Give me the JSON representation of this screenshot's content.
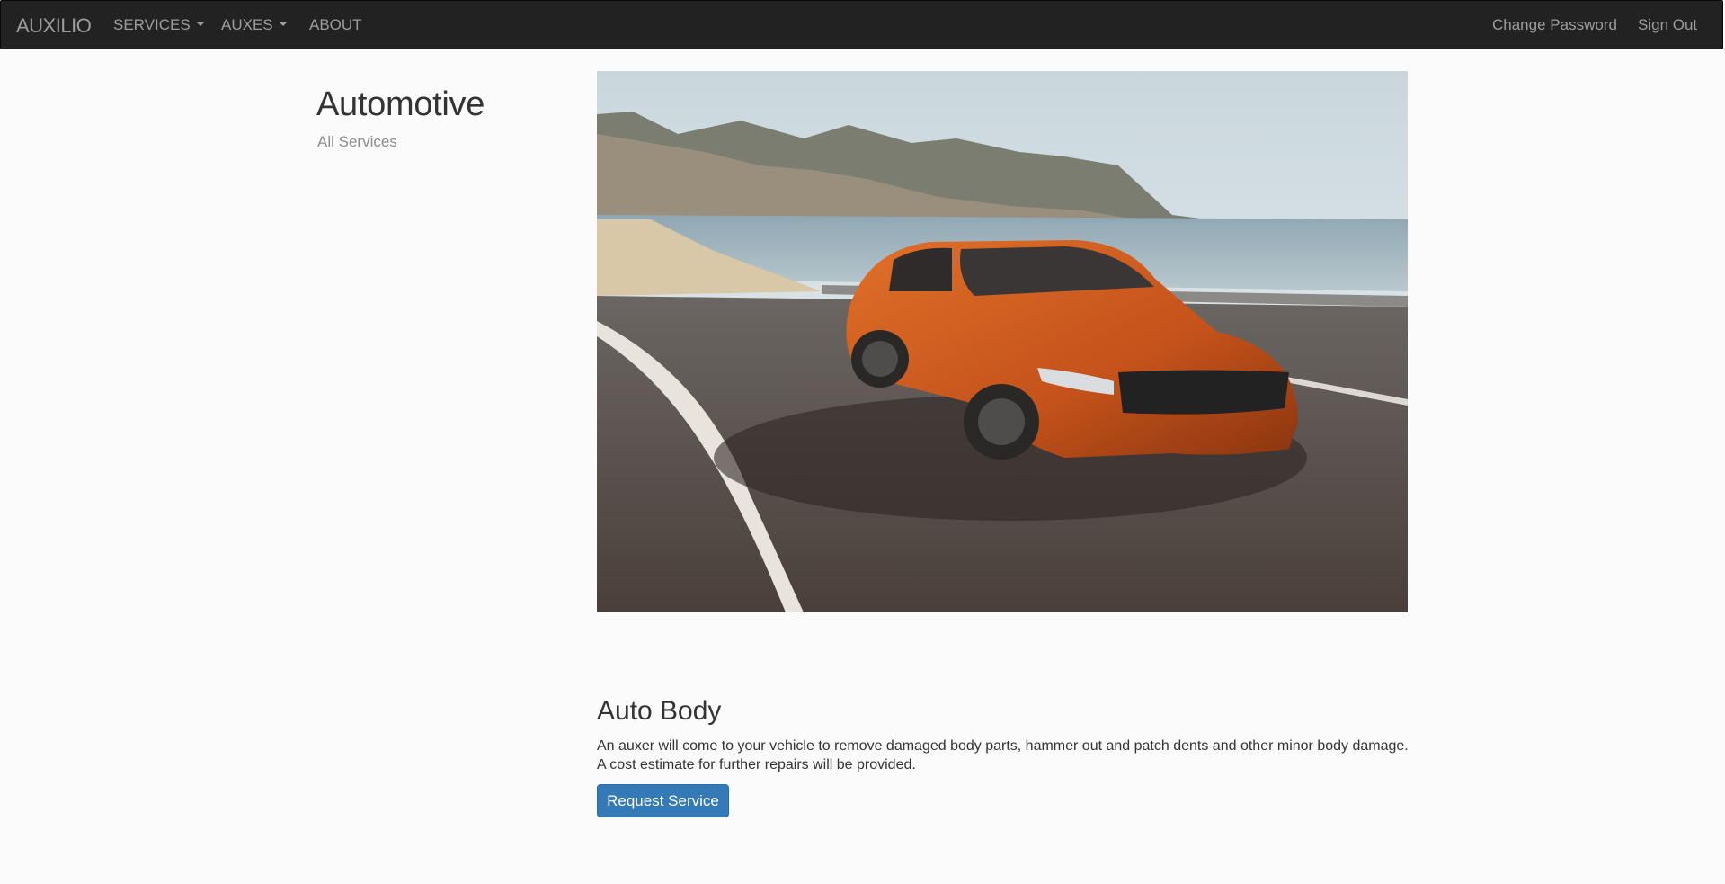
{
  "navbar": {
    "brand": "AUXILIO",
    "items": [
      {
        "label": "SERVICES",
        "dropdown": true
      },
      {
        "label": "AUXES",
        "dropdown": true
      },
      {
        "label": "ABOUT",
        "dropdown": false
      }
    ],
    "right_items": [
      {
        "label": "Change Password"
      },
      {
        "label": "Sign Out"
      }
    ]
  },
  "sidebar": {
    "title": "Automotive",
    "subtitle": "All Services"
  },
  "hero": {
    "icon": "orange-sports-car-photo"
  },
  "service": {
    "title": "Auto Body",
    "description": "An auxer will come to your vehicle to remove damaged body parts, hammer out and patch dents and other minor body damage. A cost estimate for further repairs will be provided.",
    "button_label": "Request Service"
  },
  "colors": {
    "navbar_bg": "#222222",
    "nav_text": "#9d9d9d",
    "button_primary": "#337ab7",
    "page_bg": "#fbfbfb"
  }
}
